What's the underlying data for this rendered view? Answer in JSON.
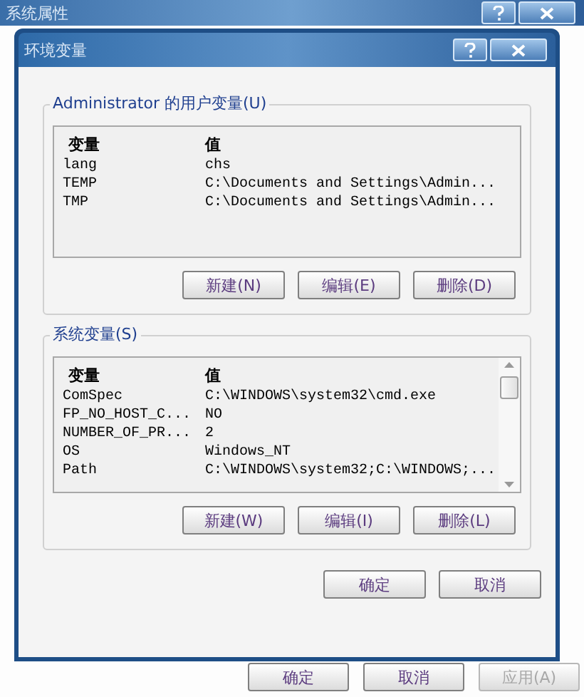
{
  "outer_window": {
    "title": "系统属性",
    "buttons": [
      {
        "label": "确定",
        "disabled": false
      },
      {
        "label": "取消",
        "disabled": false
      },
      {
        "label": "应用(A)",
        "disabled": true
      }
    ]
  },
  "dialog": {
    "title": "环境变量",
    "user_variables": {
      "label": "Administrator 的用户变量(U)",
      "columns": [
        "变量",
        "值"
      ],
      "rows": [
        [
          "lang",
          "chs"
        ],
        [
          "TEMP",
          "C:\\Documents and Settings\\Admin..."
        ],
        [
          "TMP",
          "C:\\Documents and Settings\\Admin..."
        ]
      ],
      "buttons": [
        "新建(N)",
        "编辑(E)",
        "删除(D)"
      ]
    },
    "system_variables": {
      "label": "系统变量(S)",
      "columns": [
        "变量",
        "值"
      ],
      "rows": [
        [
          "ComSpec",
          "C:\\WINDOWS\\system32\\cmd.exe"
        ],
        [
          "FP_NO_HOST_C...",
          "NO"
        ],
        [
          "NUMBER_OF_PR...",
          "2"
        ],
        [
          "OS",
          "Windows_NT"
        ],
        [
          "Path",
          "C:\\WINDOWS\\system32;C:\\WINDOWS;..."
        ]
      ],
      "buttons": [
        "新建(W)",
        "编辑(I)",
        "删除(L)"
      ]
    },
    "buttons": [
      "确定",
      "取消"
    ]
  }
}
